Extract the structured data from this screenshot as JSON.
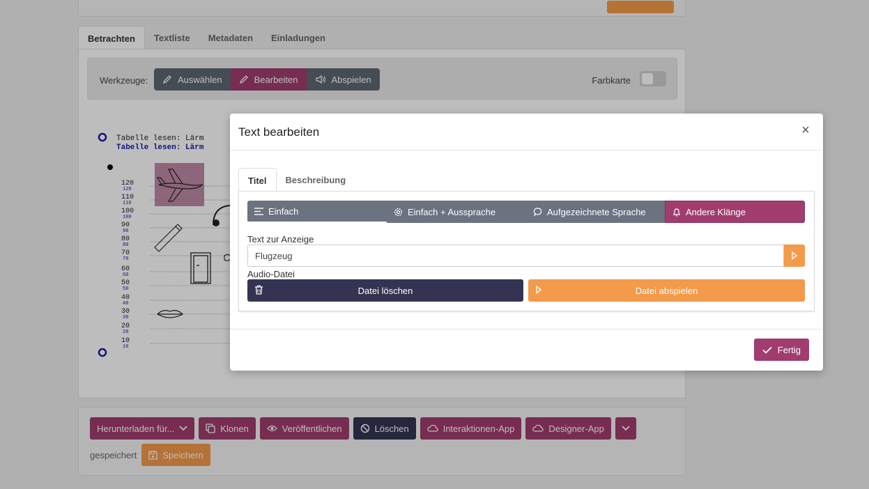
{
  "tabs": [
    "Betrachten",
    "Textliste",
    "Metadaten",
    "Einladungen"
  ],
  "toolbar": {
    "label": "Werkzeuge:",
    "buttons": [
      "Auswählen",
      "Bearbeiten",
      "Abspielen"
    ],
    "color_card_label": "Farbkarte"
  },
  "audiogram": {
    "title_1": "Tabelle lesen: Lärm",
    "title_2": "Tabelle lesen: Lärm",
    "levels": [
      "120",
      "110",
      "100",
      "90",
      "80",
      "70",
      "60",
      "50",
      "40",
      "30",
      "20",
      "10"
    ],
    "icons": [
      "airplane-icon",
      "headphones-icon",
      "phone-icon",
      "door-icon",
      "hairdryer-icon",
      "lips-icon"
    ]
  },
  "modal": {
    "title": "Text bearbeiten",
    "close_label": "×",
    "tabs": [
      "Titel",
      "Beschreibung"
    ],
    "types": [
      "Einfach",
      "Einfach + Aussprache",
      "Aufgezeichnete Sprache",
      "Andere Klänge"
    ],
    "text_label": "Text zur Anzeige",
    "text_value": "Flugzeug",
    "audio_label": "Audio-Datei",
    "delete_label": "Datei löschen",
    "play_label": "Datei abspielen",
    "done_label": "Fertig"
  },
  "bottom": {
    "buttons": [
      "Herunterladen für...",
      "Klonen",
      "Veröffentlichen",
      "Löschen",
      "Interaktionen-App",
      "Designer-App"
    ],
    "status": "gespeichert",
    "save_label": "Speichern"
  },
  "colors": {
    "magenta": "#a13d6e",
    "dark": "#343452",
    "gray": "#6b7280",
    "orange": "#f39a4b"
  }
}
